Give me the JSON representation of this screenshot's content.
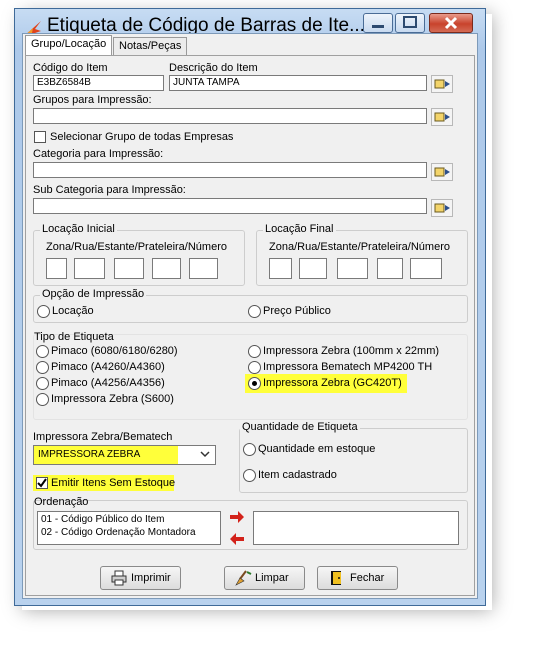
{
  "window": {
    "title": "Etiqueta de Código de Barras de Ite..."
  },
  "tabs": [
    {
      "label": "Grupo/Locação"
    },
    {
      "label": "Notas/Peças"
    }
  ],
  "item": {
    "code_label": "Código do Item",
    "code_value": "E3BZ6584B",
    "desc_label": "Descrição do Item",
    "desc_value": "JUNTA TAMPA"
  },
  "groups": {
    "label": "Grupos para Impressão:",
    "value": "",
    "select_all_label": "Selecionar Grupo de todas Empresas"
  },
  "category": {
    "label": "Categoria para Impressão:",
    "value": ""
  },
  "subcategory": {
    "label": "Sub Categoria para Impressão:",
    "value": ""
  },
  "location_start": {
    "title": "Locação Inicial",
    "sublabel": "Zona/Rua/Estante/Prateleira/Número"
  },
  "location_end": {
    "title": "Locação Final",
    "sublabel": "Zona/Rua/Estante/Prateleira/Número"
  },
  "print_option": {
    "title": "Opção de Impressão",
    "options": [
      {
        "label": "Locação"
      },
      {
        "label": "Preço Público"
      }
    ]
  },
  "label_type": {
    "title": "Tipo de Etiqueta",
    "left": [
      {
        "label": "Pimaco (6080/6180/6280)"
      },
      {
        "label": "Pimaco (A4260/A4360)"
      },
      {
        "label": "Pimaco (A4256/A4356)"
      },
      {
        "label": "Impressora Zebra (S600)"
      }
    ],
    "right": [
      {
        "label": "Impressora Zebra (100mm x 22mm)"
      },
      {
        "label": "Impressora Bematech MP4200 TH"
      },
      {
        "label": "Impressora Zebra (GC420T)"
      }
    ],
    "selected": "Impressora Zebra (GC420T)"
  },
  "printer": {
    "label": "Impressora Zebra/Bematech",
    "value": "IMPRESSORA ZEBRA",
    "emit_label": "Emitir Itens Sem Estoque",
    "emit_checked": true
  },
  "quantity": {
    "title": "Quantidade de Etiqueta",
    "options": [
      {
        "label": "Quantidade em estoque"
      },
      {
        "label": "Item cadastrado"
      }
    ]
  },
  "ordering": {
    "title": "Ordenação",
    "items": [
      "01 - Código Público do Item",
      "02 - Código Ordenação Montadora"
    ]
  },
  "buttons": {
    "print": "Imprimir",
    "clear": "Limpar",
    "close": "Fechar"
  },
  "colors": {
    "highlight": "#ffff3a",
    "titlebar": "#adc9ea",
    "close_button": "#c8432c"
  }
}
